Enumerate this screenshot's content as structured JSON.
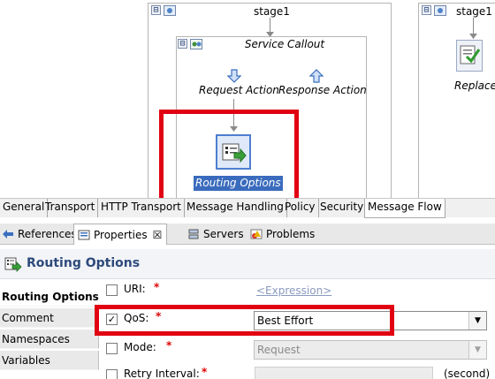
{
  "canvas": {
    "stage_left_title": "stage1",
    "stage_right_title": "stage1",
    "service_callout_title": "Service Callout",
    "request_action": "Request Action",
    "response_action": "Response Action",
    "routing_options_node": "Routing Options",
    "replace_label": "Replace",
    "collapse_symbol": "⊟"
  },
  "editor_tabs": [
    {
      "label": "General"
    },
    {
      "label": "Transport"
    },
    {
      "label": "HTTP Transport"
    },
    {
      "label": "Message Handling"
    },
    {
      "label": "Policy"
    },
    {
      "label": "Security"
    },
    {
      "label": "Message Flow",
      "active": true
    }
  ],
  "view_tabs": {
    "references": "References",
    "properties": "Properties",
    "properties_close": "☒",
    "servers": "Servers",
    "problems": "Problems"
  },
  "props": {
    "title": "Routing Options",
    "nav": [
      "Routing Options",
      "Comment",
      "Namespaces",
      "Variables"
    ],
    "uri_label": "URI:",
    "uri_link": "<Expression>",
    "qos_label": "QoS:",
    "qos_checked": "✓",
    "qos_value": "Best Effort",
    "mode_label": "Mode:",
    "mode_value": "Request",
    "retry_label": "Retry Interval:",
    "retry_unit": "(second)",
    "required_mark": "*",
    "dropdown_arrow": "▼"
  },
  "colors": {
    "highlight": "#e00012",
    "selection": "#3a6bbd",
    "title_blue": "#2e4a7c"
  }
}
